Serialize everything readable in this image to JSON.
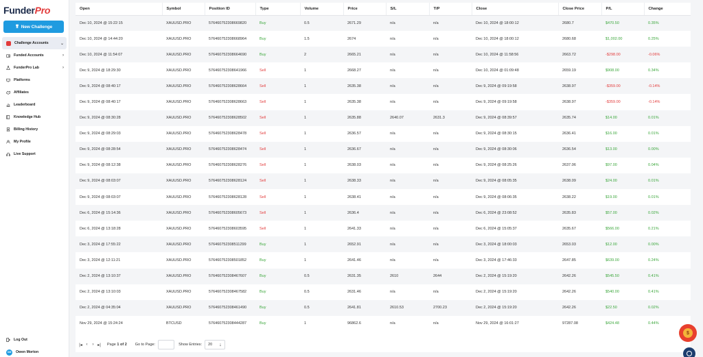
{
  "brand": {
    "part1": "Funder",
    "part2": "Pro"
  },
  "sidebar": {
    "new_challenge": "New Challenge",
    "items": [
      {
        "label": "Challenge Accounts",
        "icon": "shield-icon",
        "chevron": "⌄",
        "active": true
      },
      {
        "label": "Funded Accounts",
        "icon": "wallet-icon",
        "chevron": "›"
      },
      {
        "label": "FunderPro Lab",
        "icon": "flask-icon",
        "chevron": "›"
      },
      {
        "label": "Platforms",
        "icon": "monitor-icon",
        "chevron": ""
      },
      {
        "label": "Affiliates",
        "icon": "handshake-icon",
        "chevron": ""
      },
      {
        "label": "Leaderboard",
        "icon": "chart-icon",
        "chevron": ""
      },
      {
        "label": "Knowledge Hub",
        "icon": "book-icon",
        "chevron": ""
      },
      {
        "label": "Billing History",
        "icon": "receipt-icon",
        "chevron": ""
      },
      {
        "label": "My Profile",
        "icon": "user-icon",
        "chevron": ""
      },
      {
        "label": "Live Support",
        "icon": "headset-icon",
        "chevron": ""
      }
    ],
    "logout": "Log Out",
    "user": {
      "initials": "OM",
      "name": "Owen Morton"
    }
  },
  "table": {
    "headers": [
      "Open",
      "Symbol",
      "Position ID",
      "Type",
      "Volume",
      "Price",
      "S/L",
      "T/P",
      "Close",
      "Close Price",
      "P/L",
      "Change"
    ],
    "rows": [
      [
        "Dec 10, 2024 @ 15:22:15",
        "XAUUSD.PRO",
        "576460752308669820",
        "Buy",
        "0.5",
        "2671.29",
        "n/a",
        "n/a",
        "Dec 10, 2024 @ 18:00:12",
        "2680.7",
        "$470.50",
        "0.35%"
      ],
      [
        "Dec 10, 2024 @ 14:44:20",
        "XAUUSD.PRO",
        "576460752308668964",
        "Buy",
        "1.5",
        "2674",
        "n/a",
        "n/a",
        "Dec 10, 2024 @ 18:00:12",
        "2680.68",
        "$1,002.00",
        "0.25%"
      ],
      [
        "Dec 10, 2024 @ 11:54:07",
        "XAUUSD.PRO",
        "576460752308664690",
        "Buy",
        "2",
        "2665.21",
        "n/a",
        "n/a",
        "Dec 10, 2024 @ 11:58:56",
        "2663.72",
        "-$298.00",
        "-0.06%"
      ],
      [
        "Dec 9, 2024 @ 18:29:30",
        "XAUUSD.PRO",
        "576460752308641966",
        "Sell",
        "1",
        "2668.27",
        "n/a",
        "n/a",
        "Dec 10, 2024 @ 01:09:48",
        "2659.19",
        "$908.00",
        "0.34%"
      ],
      [
        "Dec 9, 2024 @ 08:40:17",
        "XAUUSD.PRO",
        "576460752308628664",
        "Sell",
        "1",
        "2635.38",
        "n/a",
        "n/a",
        "Dec 9, 2024 @ 09:19:58",
        "2638.97",
        "-$359.00",
        "-0.14%"
      ],
      [
        "Dec 9, 2024 @ 08:40:17",
        "XAUUSD.PRO",
        "576460752308628663",
        "Sell",
        "1",
        "2635.38",
        "n/a",
        "n/a",
        "Dec 9, 2024 @ 09:19:58",
        "2638.97",
        "-$359.00",
        "-0.14%"
      ],
      [
        "Dec 9, 2024 @ 08:30:28",
        "XAUUSD.PRO",
        "576460752308628502",
        "Sell",
        "1",
        "2635.88",
        "2640.07",
        "2631.3",
        "Dec 9, 2024 @ 08:39:57",
        "2635.74",
        "$14.00",
        "0.01%"
      ],
      [
        "Dec 9, 2024 @ 08:29:03",
        "XAUUSD.PRO",
        "576460752308628478",
        "Sell",
        "1",
        "2636.57",
        "n/a",
        "n/a",
        "Dec 9, 2024 @ 08:30:15",
        "2636.41",
        "$16.00",
        "0.01%"
      ],
      [
        "Dec 9, 2024 @ 08:28:54",
        "XAUUSD.PRO",
        "576460752308628474",
        "Sell",
        "1",
        "2636.67",
        "n/a",
        "n/a",
        "Dec 9, 2024 @ 08:30:06",
        "2636.54",
        "$13.00",
        "0.00%"
      ],
      [
        "Dec 9, 2024 @ 08:12:38",
        "XAUUSD.PRO",
        "576460752308628276",
        "Sell",
        "1",
        "2638.03",
        "n/a",
        "n/a",
        "Dec 9, 2024 @ 08:25:26",
        "2637.06",
        "$97.00",
        "0.04%"
      ],
      [
        "Dec 9, 2024 @ 08:03:07",
        "XAUUSD.PRO",
        "576460752308628124",
        "Sell",
        "1",
        "2638.33",
        "n/a",
        "n/a",
        "Dec 9, 2024 @ 08:05:35",
        "2638.09",
        "$24.00",
        "0.01%"
      ],
      [
        "Dec 9, 2024 @ 08:03:07",
        "XAUUSD.PRO",
        "576460752308628128",
        "Sell",
        "1",
        "2638.41",
        "n/a",
        "n/a",
        "Dec 9, 2024 @ 08:06:35",
        "2638.22",
        "$19.00",
        "0.01%"
      ],
      [
        "Dec 6, 2024 @ 15:14:36",
        "XAUUSD.PRO",
        "576460752308605673",
        "Sell",
        "1",
        "2636.4",
        "n/a",
        "n/a",
        "Dec 6, 2024 @ 23:08:52",
        "2635.83",
        "$57.00",
        "0.02%"
      ],
      [
        "Dec 6, 2024 @ 13:18:28",
        "XAUUSD.PRO",
        "576460752308603595",
        "Sell",
        "1",
        "2641.33",
        "n/a",
        "n/a",
        "Dec 6, 2024 @ 15:05:37",
        "2635.67",
        "$566.00",
        "0.21%"
      ],
      [
        "Dec 3, 2024 @ 17:55:22",
        "XAUUSD.PRO",
        "576460752308511299",
        "Buy",
        "1",
        "2652.91",
        "n/a",
        "n/a",
        "Dec 3, 2024 @ 18:00:03",
        "2653.03",
        "$12.00",
        "0.00%"
      ],
      [
        "Dec 3, 2024 @ 12:11:21",
        "XAUUSD.PRO",
        "576460752308501852",
        "Buy",
        "1",
        "2641.46",
        "n/a",
        "n/a",
        "Dec 3, 2024 @ 17:46:33",
        "2647.85",
        "$639.00",
        "0.24%"
      ],
      [
        "Dec 2, 2024 @ 13:10:37",
        "XAUUSD.PRO",
        "576460752308467607",
        "Buy",
        "0.5",
        "2631.35",
        "2610",
        "2644",
        "Dec 2, 2024 @ 15:19:20",
        "2642.26",
        "$545.50",
        "0.41%"
      ],
      [
        "Dec 2, 2024 @ 13:10:03",
        "XAUUSD.PRO",
        "576460752308467582",
        "Buy",
        "0.5",
        "2631.46",
        "n/a",
        "n/a",
        "Dec 2, 2024 @ 15:19:20",
        "2642.26",
        "$540.00",
        "0.41%"
      ],
      [
        "Dec 2, 2024 @ 04:35:04",
        "XAUUSD.PRO",
        "576460752308461490",
        "Buy",
        "0.5",
        "2641.81",
        "2610.53",
        "2700.23",
        "Dec 2, 2024 @ 15:19:20",
        "2642.26",
        "$22.50",
        "0.02%"
      ],
      [
        "Nov 29, 2024 @ 15:24:24",
        "BTCUSD",
        "576460752308444287",
        "Buy",
        "1",
        "96862.6",
        "n/a",
        "n/a",
        "Nov 29, 2024 @ 16:01:27",
        "97287.08",
        "$424.48",
        "0.44%"
      ]
    ]
  },
  "pager": {
    "page_prefix": "Page",
    "page_current": "1",
    "page_sep": "of",
    "page_total": "2",
    "goto_label": "Go to Page:",
    "goto_value": "",
    "entries_label": "Show Entries:",
    "entries_value": "20"
  },
  "colors": {
    "positive": "#3aa63a",
    "negative": "#e23b3b",
    "accent": "#1f9be0"
  }
}
